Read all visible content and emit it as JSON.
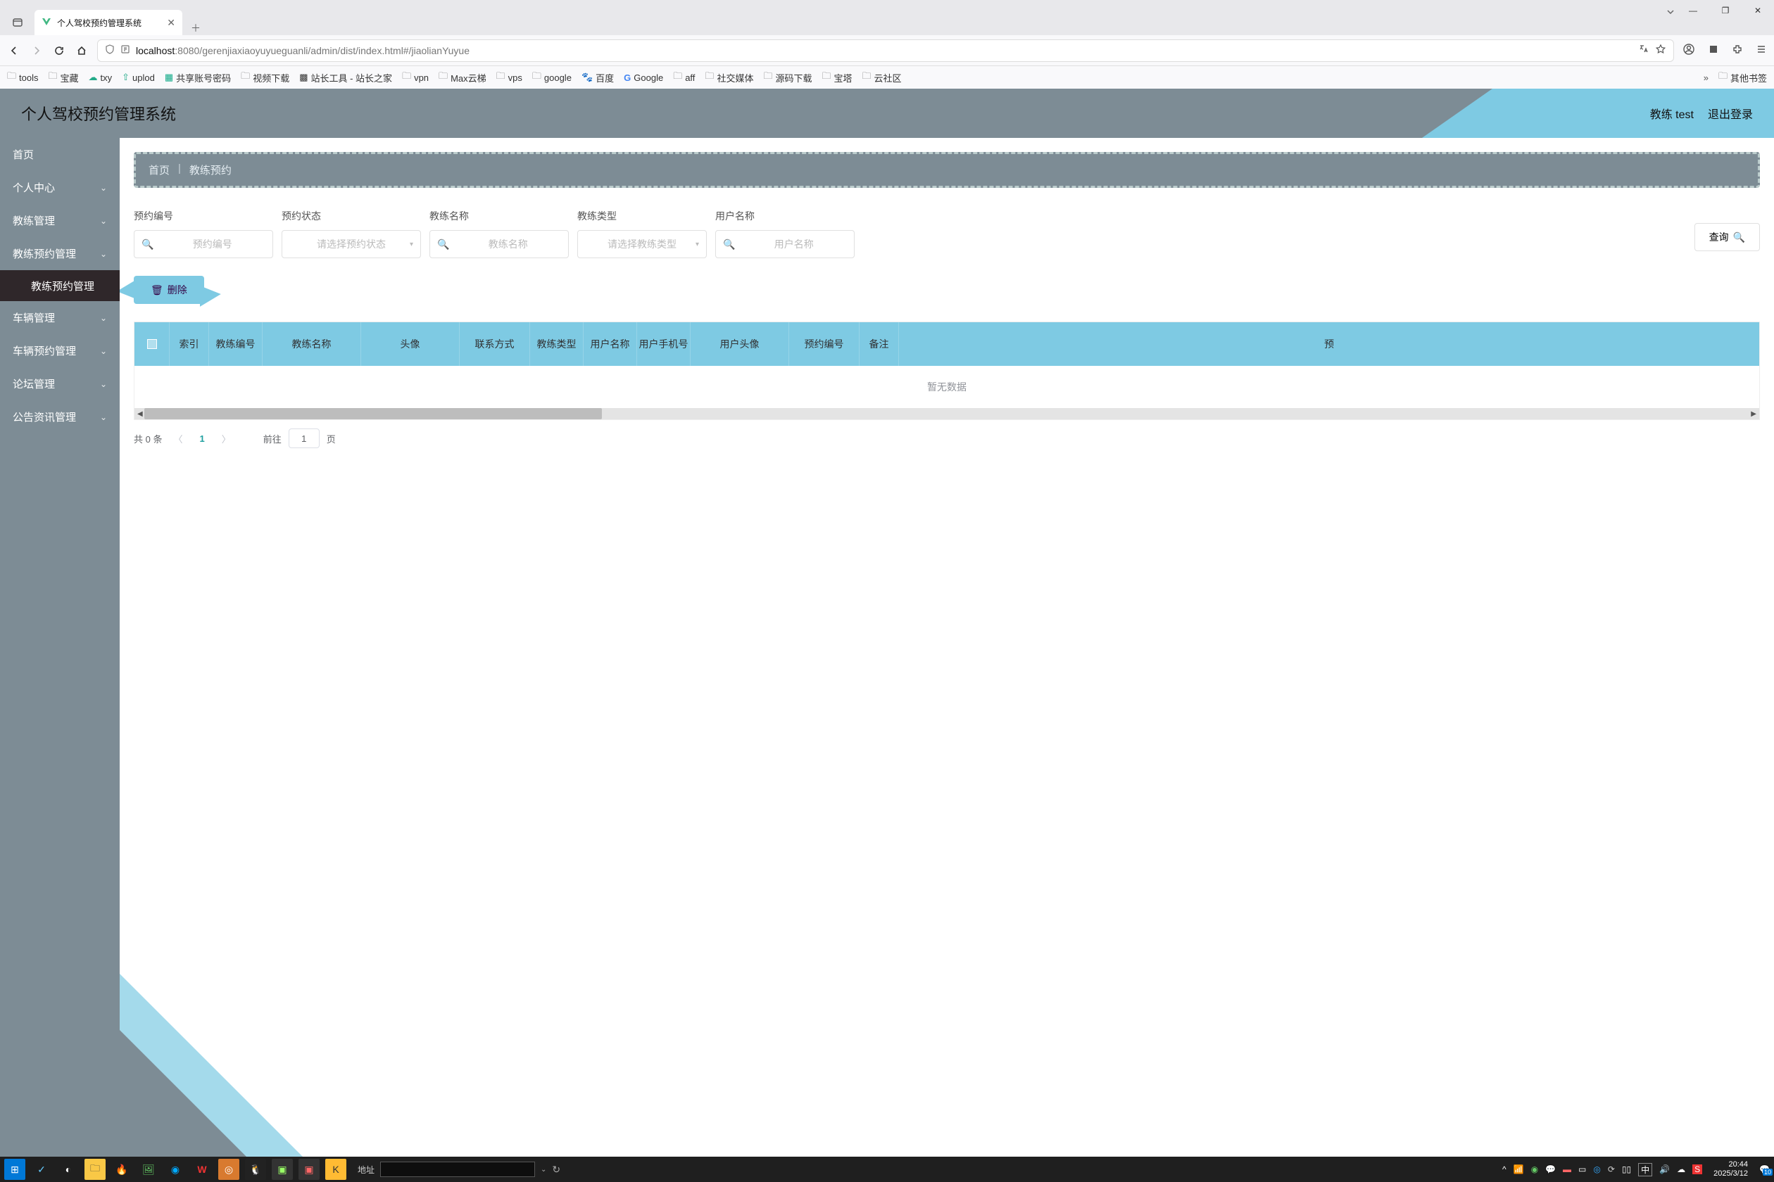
{
  "browser": {
    "tab_title": "个人驾校预约管理系统",
    "url_host": "localhost",
    "url_path": ":8080/gerenjiaxiaoyuyueguanli/admin/dist/index.html#/jiaolianYuyue"
  },
  "bookmarks": [
    "tools",
    "宝藏",
    "txy",
    "uplod",
    "共享账号密码",
    "视频下载",
    "站长工具 - 站长之家",
    "vpn",
    "Max云梯",
    "vps",
    "google",
    "百度",
    "Google",
    "aff",
    "社交媒体",
    "源码下载",
    "宝塔",
    "云社区"
  ],
  "bookmark_other": "其他书签",
  "app": {
    "title": "个人驾校预约管理系统",
    "user_label": "教练 test",
    "logout": "退出登录"
  },
  "sidebar": {
    "items": [
      {
        "label": "首页",
        "has_children": false
      },
      {
        "label": "个人中心",
        "has_children": true
      },
      {
        "label": "教练管理",
        "has_children": true
      },
      {
        "label": "教练预约管理",
        "has_children": true,
        "expanded": true,
        "sub": {
          "label": "教练预约管理"
        }
      },
      {
        "label": "车辆管理",
        "has_children": true
      },
      {
        "label": "车辆预约管理",
        "has_children": true
      },
      {
        "label": "论坛管理",
        "has_children": true
      },
      {
        "label": "公告资讯管理",
        "has_children": true
      }
    ]
  },
  "breadcrumb": {
    "home": "首页",
    "current": "教练预约"
  },
  "filters": {
    "f1": {
      "label": "预约编号",
      "placeholder": "预约编号"
    },
    "f2": {
      "label": "预约状态",
      "placeholder": "请选择预约状态"
    },
    "f3": {
      "label": "教练名称",
      "placeholder": "教练名称"
    },
    "f4": {
      "label": "教练类型",
      "placeholder": "请选择教练类型"
    },
    "f5": {
      "label": "用户名称",
      "placeholder": "用户名称"
    },
    "search_btn": "查询"
  },
  "delete_btn": "删除",
  "table": {
    "headers": [
      "索引",
      "教练编号",
      "教练名称",
      "头像",
      "联系方式",
      "教练类型",
      "用户名称",
      "用户手机号",
      "用户头像",
      "预约编号",
      "备注",
      "预"
    ],
    "empty": "暂无数据"
  },
  "pagination": {
    "total": "共 0 条",
    "current": "1",
    "goto_prefix": "前往",
    "goto_value": "1",
    "goto_suffix": "页"
  },
  "taskbar": {
    "addr_label": "地址",
    "time": "20:44",
    "date": "2025/3/12",
    "ime": "中",
    "notif": "10"
  }
}
